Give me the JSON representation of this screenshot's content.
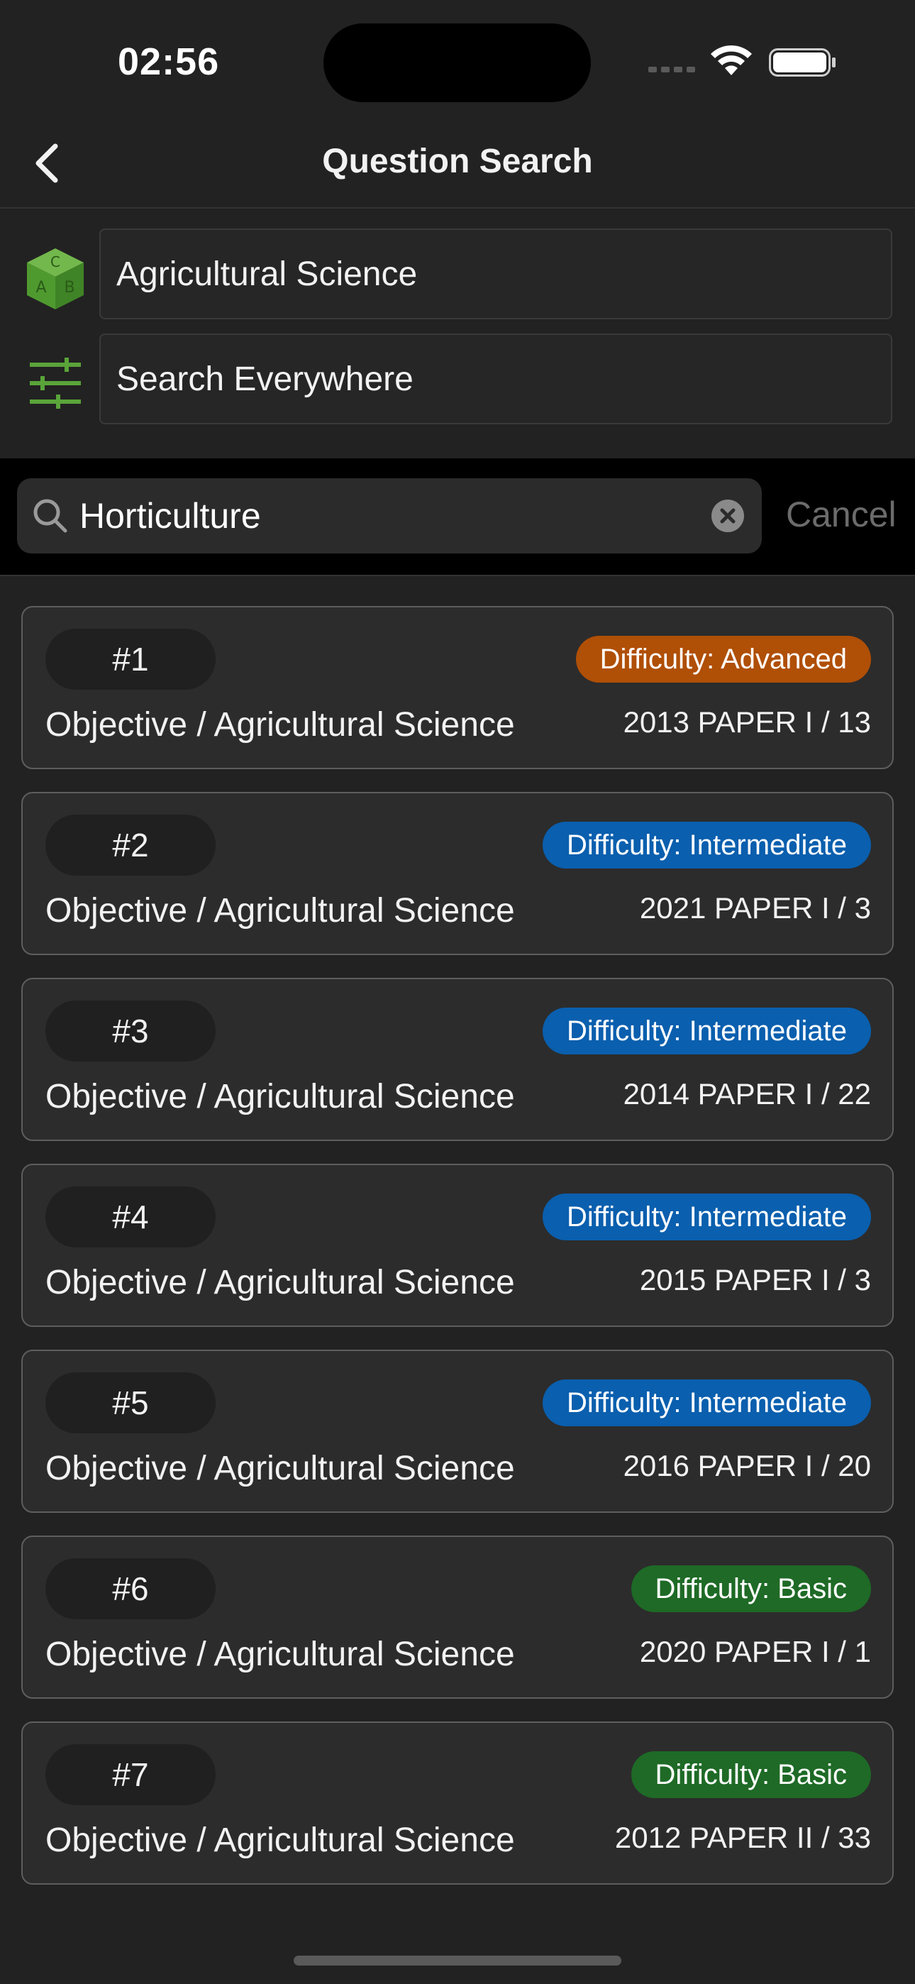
{
  "status_bar": {
    "time": "02:56"
  },
  "nav": {
    "title": "Question Search"
  },
  "filters": {
    "subject": "Agricultural Science",
    "scope": "Search Everywhere"
  },
  "search": {
    "value": "Horticulture",
    "cancel_label": "Cancel"
  },
  "colors": {
    "advanced": "#b04f06",
    "intermediate": "#0a5fae",
    "basic": "#1e6a26",
    "accent_green": "#5aa43a"
  },
  "results": [
    {
      "number": "#1",
      "difficulty": "Difficulty: Advanced",
      "level": "advanced",
      "subject": "Objective / Agricultural Science",
      "ref": "2013 PAPER I / 13"
    },
    {
      "number": "#2",
      "difficulty": "Difficulty: Intermediate",
      "level": "intermediate",
      "subject": "Objective / Agricultural Science",
      "ref": "2021 PAPER I / 3"
    },
    {
      "number": "#3",
      "difficulty": "Difficulty: Intermediate",
      "level": "intermediate",
      "subject": "Objective / Agricultural Science",
      "ref": "2014 PAPER I / 22"
    },
    {
      "number": "#4",
      "difficulty": "Difficulty: Intermediate",
      "level": "intermediate",
      "subject": "Objective / Agricultural Science",
      "ref": "2015 PAPER I / 3"
    },
    {
      "number": "#5",
      "difficulty": "Difficulty: Intermediate",
      "level": "intermediate",
      "subject": "Objective / Agricultural Science",
      "ref": "2016 PAPER I / 20"
    },
    {
      "number": "#6",
      "difficulty": "Difficulty: Basic",
      "level": "basic",
      "subject": "Objective / Agricultural Science",
      "ref": "2020 PAPER I / 1"
    },
    {
      "number": "#7",
      "difficulty": "Difficulty: Basic",
      "level": "basic",
      "subject": "Objective / Agricultural Science",
      "ref": "2012 PAPER II / 33"
    }
  ]
}
